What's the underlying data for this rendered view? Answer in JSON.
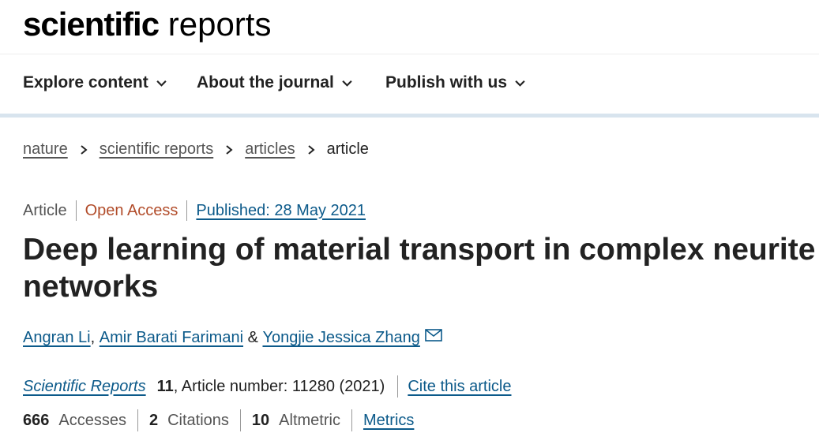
{
  "logo": {
    "bold": "scientific",
    "light": " reports"
  },
  "nav": [
    {
      "label": "Explore content"
    },
    {
      "label": "About the journal"
    },
    {
      "label": "Publish with us"
    }
  ],
  "breadcrumb": [
    "nature",
    "scientific reports",
    "articles",
    "article"
  ],
  "meta": {
    "type": "Article",
    "access": "Open Access",
    "published": "Published: 28 May 2021"
  },
  "title": "Deep learning of material transport in complex neurite networks",
  "authors": {
    "a1": "Angran Li",
    "sep1": ", ",
    "a2": "Amir Barati Farimani",
    "amp": " & ",
    "a3": "Yongjie Jessica Zhang"
  },
  "citation": {
    "journal": "Scientific Reports",
    "volume": "11",
    "rest": ", Article number: 11280 (2021)",
    "cite_link": "Cite this article"
  },
  "metrics": {
    "accesses_num": "666",
    "accesses_label": "Accesses",
    "citations_num": "2",
    "citations_label": "Citations",
    "altmetric_num": "10",
    "altmetric_label": "Altmetric",
    "metrics_link": "Metrics"
  },
  "icons": {
    "chevron": "chevron-down-icon",
    "mail": "mail-icon",
    "separator": "chevron-right-icon"
  },
  "colors": {
    "link": "#0c5a8a",
    "open_access": "#b24d2b",
    "nav_rule": "#d8e4ee"
  }
}
